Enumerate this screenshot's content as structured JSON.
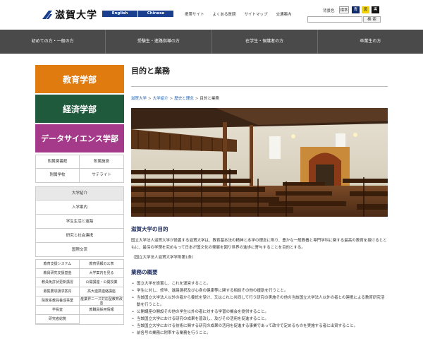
{
  "header": {
    "logo_text": "滋賀大学",
    "lang_buttons": [
      "English",
      "Chinese"
    ],
    "links": [
      "携帯サイト",
      "よくある質問",
      "サイトマップ",
      "交通案内"
    ],
    "bg_label": "背景色",
    "bg_buttons": [
      "標準",
      "青",
      "黄",
      "黒"
    ],
    "search_button": "検 索"
  },
  "gnav": [
    "初めての方・一般の方",
    "受験生・進路指導の方",
    "在学生・保護者の方",
    "卒業生の方"
  ],
  "sidebar": {
    "faculties": [
      "教育学部",
      "経済学部",
      "データサイエンス学部"
    ],
    "facilities": [
      "附属図書館",
      "附属施設",
      "附属学校",
      "サテライト"
    ],
    "menu_head": "大学紹介",
    "menu_items": [
      "入学案内",
      "学生生活と進路",
      "研究と社会連携",
      "国際交流"
    ],
    "links": [
      "教育支援システム",
      "教育情報の公表",
      "教員研究支援基金",
      "大学案内を見る",
      "教員免許状更新講習",
      "公開講座・公開授業",
      "募集要項請求案内",
      "高大連携連絡講座",
      "院数系教員養成事業",
      "産業界ニーズ対応型教育改善",
      "学長室",
      "教職員採用情報",
      "研究者総覧"
    ]
  },
  "main": {
    "title": "目的と業務",
    "breadcrumb": [
      "滋賀大学",
      "大学紹介",
      "歴史と理念",
      "目的と業務"
    ],
    "section1_title": "滋賀大学の目的",
    "section1_text": "国立大学法人滋賀大学が設置する滋賀大学は、教育基本法の精神と本学の理念に則り、豊かな一般教養と専門学科に関する最高の教育を授けるとともに、最深の学理を究めもって日本が国文化の発展を図り世界の進歩に寄与することを目的とする。",
    "section1_note": "（国立大学法人滋賀大学学則第1条）",
    "section2_title": "業務の概要",
    "bullets": [
      "国立大学を設置し、これを運営すること。",
      "学生に対し、修学、進路選択及び心身の健康等に関する相談その他の援助を行うこと。",
      "当該国立大学法人以外の者から委託を受け、又はこれと共同して行う研究の実施その他の当該国立大学法人以外の者との連携による教育研究活動を行うこと。",
      "公開講座の開設その他の学生以外の者に対する学習の機会を提供すること。",
      "当該国立大学における研究の成果を普及し、及びその活用を促進すること。",
      "当該国立大学における技術に関する研究の成果の活用を促進する事業であって政令で定めるものを実施する者に出資すること。",
      "前各号の業務に附帯する業務を行うこと。"
    ]
  },
  "colors": {
    "lang_blue": "#1b3f8f",
    "nav_gray": "#4a4a4a",
    "edu_orange": "#e07b10",
    "eco_green": "#1f5a3d",
    "ds_purple": "#a53a8a",
    "link_blue": "#1f5fb0"
  }
}
